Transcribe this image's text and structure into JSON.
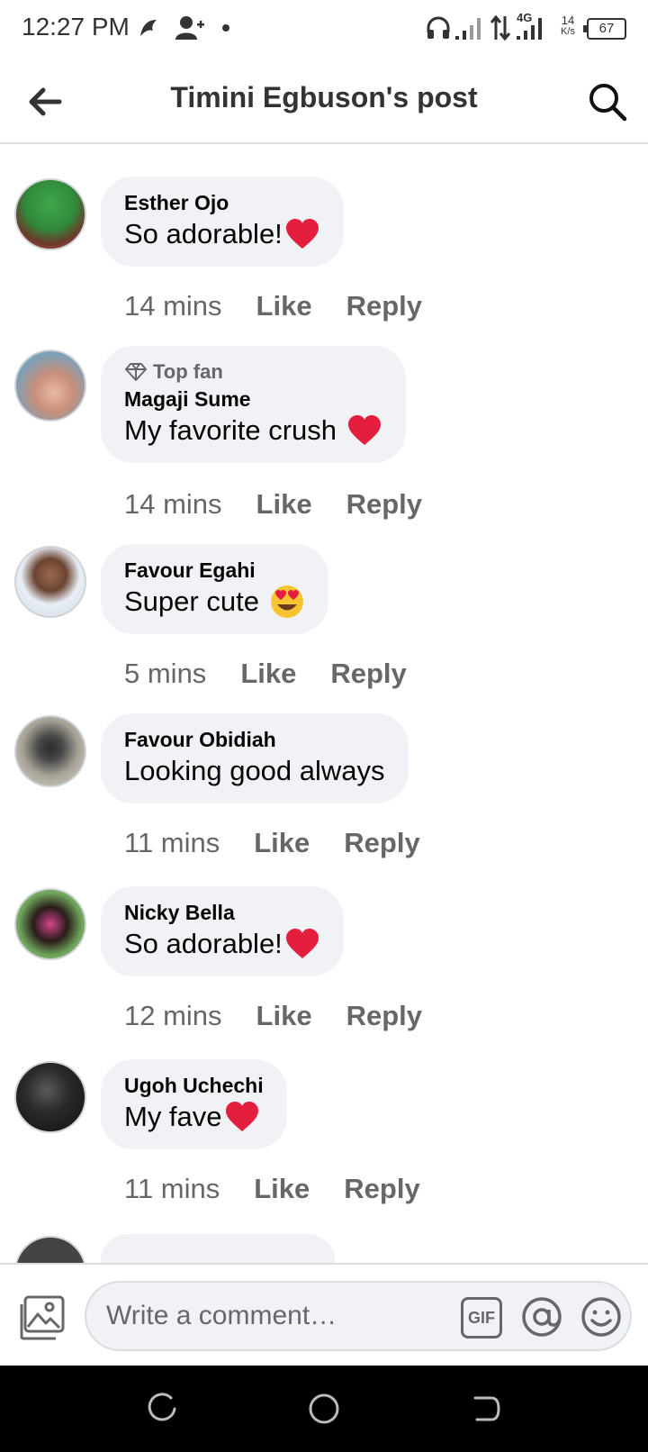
{
  "status_bar": {
    "time": "12:27 PM",
    "network_type": "4G",
    "speed_value": "14",
    "speed_unit": "K/s",
    "battery": "67"
  },
  "header": {
    "title": "Timini Egbuson's post",
    "back_icon": "back-arrow-icon",
    "search_icon": "search-icon"
  },
  "comments": [
    {
      "author": "Esther Ojo",
      "text": "So adorable!",
      "emoji": "❤️",
      "time": "14 mins",
      "like": "Like",
      "reply": "Reply"
    },
    {
      "badge": "Top fan",
      "author": "Magaji Sume",
      "text": "My favorite crush ",
      "emoji": "❤️",
      "time": "14 mins",
      "like": "Like",
      "reply": "Reply"
    },
    {
      "author": "Favour Egahi",
      "text": "Super cute ",
      "emoji": "😍",
      "time": "5 mins",
      "like": "Like",
      "reply": "Reply"
    },
    {
      "author": "Favour Obidiah",
      "text": "Looking good always",
      "emoji": "",
      "time": "11 mins",
      "like": "Like",
      "reply": "Reply"
    },
    {
      "author": "Nicky Bella",
      "text": "So adorable!",
      "emoji": "❤️",
      "time": "12 mins",
      "like": "Like",
      "reply": "Reply"
    },
    {
      "author": "Ugoh Uchechi",
      "text": "My fave",
      "emoji": "❤️",
      "time": "11 mins",
      "like": "Like",
      "reply": "Reply"
    }
  ],
  "composer": {
    "placeholder": "Write a comment…",
    "gif_label": "GIF"
  },
  "colors": {
    "bubble": "#f0f2f5",
    "secondary_text": "#65676b",
    "divider": "#dadde1",
    "heart": "#e41e3f"
  }
}
